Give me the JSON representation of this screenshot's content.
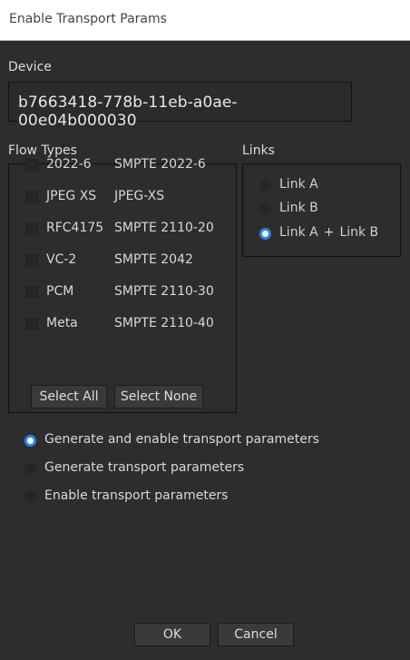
{
  "window": {
    "title": "Enable Transport Params"
  },
  "device": {
    "label": "Device",
    "value": "b7663418-778b-11eb-a0ae-00e04b000030"
  },
  "flow_types": {
    "label": "Flow Types",
    "items": [
      {
        "code": "2022-6",
        "standard": "SMPTE 2022-6",
        "checked": false
      },
      {
        "code": "JPEG XS",
        "standard": "JPEG-XS",
        "checked": false
      },
      {
        "code": "RFC4175",
        "standard": "SMPTE 2110-20",
        "checked": false
      },
      {
        "code": "VC-2",
        "standard": "SMPTE 2042",
        "checked": false
      },
      {
        "code": "PCM",
        "standard": "SMPTE 2110-30",
        "checked": false
      },
      {
        "code": "Meta",
        "standard": "SMPTE 2110-40",
        "checked": false
      }
    ],
    "select_all_label": "Select All",
    "select_none_label": "Select None"
  },
  "links": {
    "label": "Links",
    "options": [
      {
        "label": "Link A",
        "selected": false
      },
      {
        "label": "Link B",
        "selected": false
      },
      {
        "label_a": "Link A",
        "plus": "+",
        "label_b": "Link B",
        "selected": true
      }
    ]
  },
  "mode": {
    "options": [
      {
        "label": "Generate and enable transport parameters",
        "selected": true
      },
      {
        "label": "Generate transport parameters",
        "selected": false
      },
      {
        "label": "Enable transport parameters",
        "selected": false
      }
    ]
  },
  "footer": {
    "ok_label": "OK",
    "cancel_label": "Cancel"
  },
  "colors": {
    "background": "#2d2d2d",
    "accent": "#2a86e6",
    "titlebar": "#ffffff"
  }
}
